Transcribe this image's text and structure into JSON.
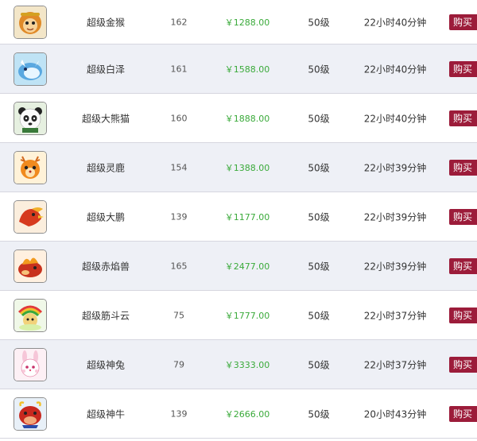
{
  "items": [
    {
      "name": "超级金猴",
      "number": "162",
      "price": "￥1288.00",
      "level": "50级",
      "time_left": "22小时40分钟",
      "buy_label": "购买",
      "icon": "golden-monkey-pet-icon"
    },
    {
      "name": "超级白泽",
      "number": "161",
      "price": "￥1588.00",
      "level": "50级",
      "time_left": "22小时40分钟",
      "buy_label": "购买",
      "icon": "white-beast-pet-icon"
    },
    {
      "name": "超级大熊猫",
      "number": "160",
      "price": "￥1888.00",
      "level": "50级",
      "time_left": "22小时40分钟",
      "buy_label": "购买",
      "icon": "panda-pet-icon"
    },
    {
      "name": "超级灵鹿",
      "number": "154",
      "price": "￥1388.00",
      "level": "50级",
      "time_left": "22小时39分钟",
      "buy_label": "购买",
      "icon": "deer-pet-icon"
    },
    {
      "name": "超级大鹏",
      "number": "139",
      "price": "￥1177.00",
      "level": "50级",
      "time_left": "22小时39分钟",
      "buy_label": "购买",
      "icon": "roc-bird-pet-icon"
    },
    {
      "name": "超级赤焰兽",
      "number": "165",
      "price": "￥2477.00",
      "level": "50级",
      "time_left": "22小时39分钟",
      "buy_label": "购买",
      "icon": "flame-beast-pet-icon"
    },
    {
      "name": "超级筋斗云",
      "number": "75",
      "price": "￥1777.00",
      "level": "50级",
      "time_left": "22小时37分钟",
      "buy_label": "购买",
      "icon": "cloud-pet-icon"
    },
    {
      "name": "超级神兔",
      "number": "79",
      "price": "￥3333.00",
      "level": "50级",
      "time_left": "22小时37分钟",
      "buy_label": "购买",
      "icon": "rabbit-pet-icon"
    },
    {
      "name": "超级神牛",
      "number": "139",
      "price": "￥2666.00",
      "level": "50级",
      "time_left": "20小时43分钟",
      "buy_label": "购买",
      "icon": "bull-pet-icon"
    }
  ],
  "colors": {
    "price": "#3aaa3a",
    "buy_button": "#9c1c3a",
    "row_alt": "#eef0f6",
    "divider": "#d6d6df"
  }
}
